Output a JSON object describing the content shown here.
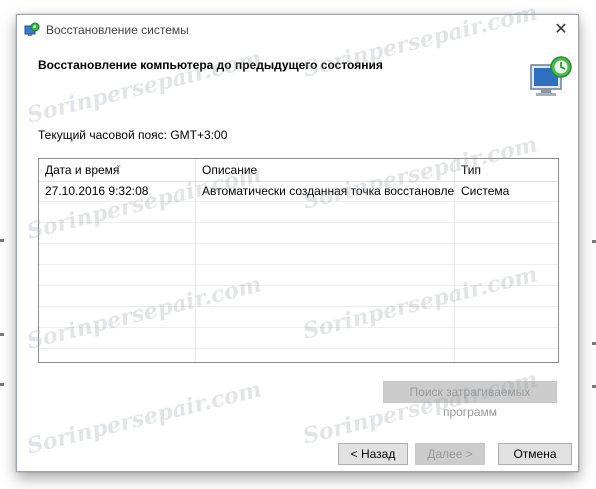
{
  "window": {
    "title": "Восстановление системы",
    "close_glyph": "✕"
  },
  "header": {
    "title": "Восстановление компьютера до предыдущего состояния",
    "icon": "system-restore-icon"
  },
  "timezone_label": "Текущий часовой пояс: GMT+3:00",
  "table": {
    "columns": [
      "Дата и время",
      "Описание",
      "Тип"
    ],
    "rows": [
      [
        "27.10.2016 9:32:08",
        "Автоматически созданная точка восстановле...",
        "Система"
      ]
    ]
  },
  "buttons": {
    "search": "Поиск затрагиваемых программ",
    "back": "< Назад",
    "next": "Далее >",
    "cancel": "Отмена"
  },
  "watermark_text": "Sorinpersepair.com",
  "colors": {
    "window_border": "#9aa6b8",
    "disabled_text": "#9a9a9a"
  }
}
